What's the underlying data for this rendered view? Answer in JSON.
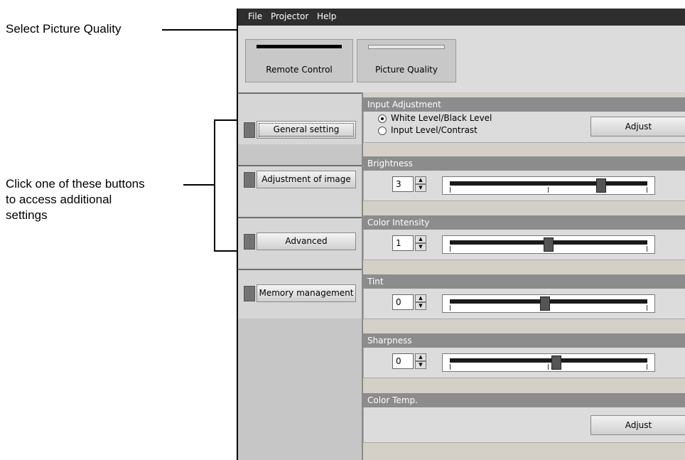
{
  "callouts": {
    "select_prefix": "Select ",
    "select_bold": "Picture Quality",
    "buttons_text": "Click one of these buttons\nto access additional\nsettings"
  },
  "menu": [
    "File",
    "Projector",
    "Help"
  ],
  "toolbar": {
    "remote_control": "Remote Control",
    "picture_quality": "Picture Quality"
  },
  "sidebar": {
    "items": [
      {
        "label": "General setting"
      },
      {
        "label": "Adjustment of image"
      },
      {
        "label": "Advanced"
      },
      {
        "label": "Memory management"
      }
    ]
  },
  "panels": {
    "input_adjustment": {
      "title": "Input Adjustment",
      "option1": "White Level/Black Level",
      "option2": "Input Level/Contrast",
      "selected": "White Level/Black Level",
      "button": "Adjust"
    },
    "brightness": {
      "title": "Brightness",
      "value": "3",
      "level": 0.78
    },
    "color_intensity": {
      "title": "Color Intensity",
      "value": "1",
      "level": 0.5
    },
    "tint": {
      "title": "Tint",
      "value": "0",
      "level": 0.48
    },
    "sharpness": {
      "title": "Sharpness",
      "value": "0",
      "level": 0.54
    },
    "color_temp": {
      "title": "Color Temp.",
      "button": "Adjust"
    }
  }
}
